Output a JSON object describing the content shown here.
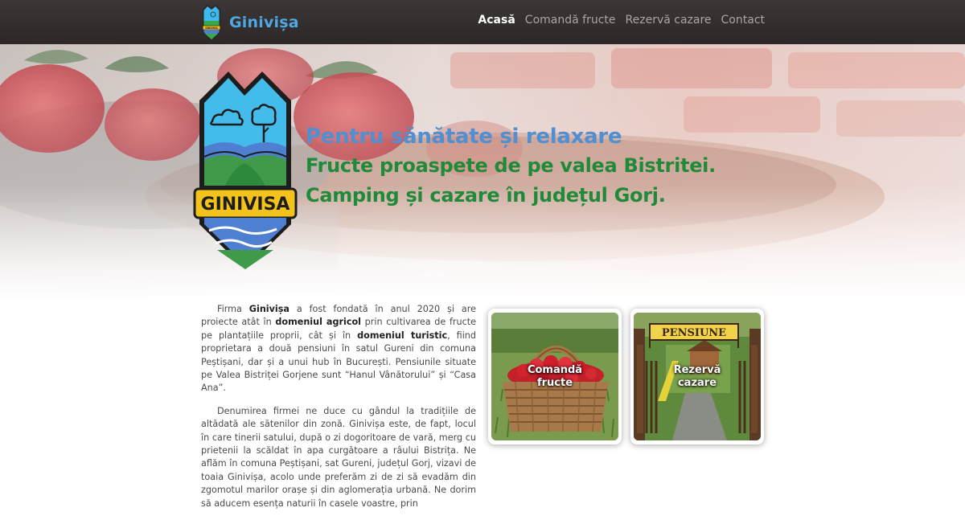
{
  "navbar": {
    "brand_name": "Ginivișa",
    "links": [
      "Acasă",
      "Comandă fructe",
      "Rezervă cazare",
      "Contact"
    ],
    "active_link": "Acasă"
  },
  "hero": {
    "logo_text": "GINIVISA",
    "line1": "Pentru sănătate și relaxare",
    "line2": "Fructe proaspete de pe valea Bistritei.",
    "line3": "Camping și cazare în județul Gorj."
  },
  "content": {
    "p1": {
      "t1": "Firma ",
      "b1": "Ginivișa",
      "t2": " a fost fondată în anul 2020 și are proiecte atât în ",
      "b2": "domeniul agricol",
      "t3": " prin cultivarea de fructe pe plantațiile proprii, cât și în ",
      "b3": "domeniul turistic",
      "t4": ", fiind proprietara a două pensiuni în satul Gureni din comuna Peștișani, dar și a unui hub în București. Pensiunile situate pe Valea Bistriței Gorjene sunt “Hanul Vânătorului” și “Casa Ana”."
    },
    "p2": "Denumirea firmei ne duce cu gândul la tradițiile de altădată ale sătenilor din zonă. Ginivișa este, de fapt, locul în care tinerii satului, după o zi dogoritoare de vară, merg cu prietenii la scăldat în apa curgătoare a râului Bistrița. Ne aflăm în comuna Peștișani, sat Gureni, județul Gorj, vizavi de toaia Ginivișa, acolo unde preferăm zi de zi să evadăm din zgomotul marilor orașe și din aglomerația urbană. Ne dorim să aducem esența naturii în casele voastre, prin"
  },
  "cards": [
    {
      "label_line1": "Comandă",
      "label_line2": "fructe"
    },
    {
      "label_line1": "Rezervă",
      "label_line2": "cazare",
      "sign_text": "PENSIUNE"
    }
  ],
  "colors": {
    "brand_blue": "#4fa7e3",
    "hero_blue": "#4f8fd2",
    "hero_green": "#218a3a",
    "logo_yellow": "#f3c21b",
    "navbar_bg": "#2f2a2a"
  }
}
